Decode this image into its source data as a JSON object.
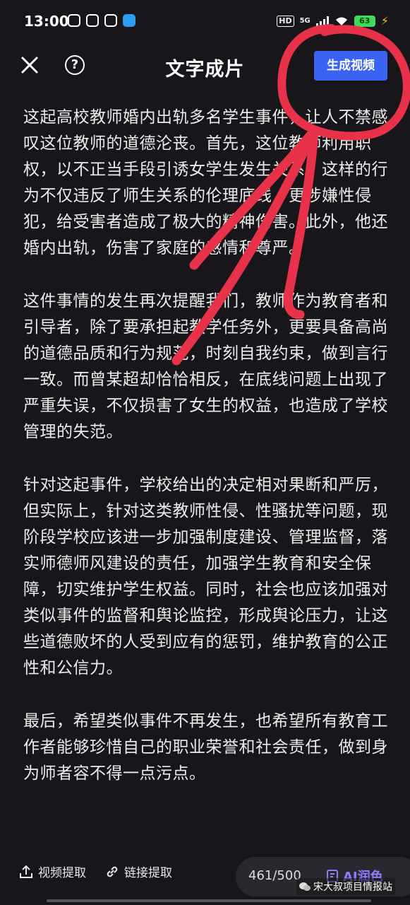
{
  "status_bar": {
    "time": "13:00",
    "hd_label": "HD",
    "network_label": "5G",
    "battery_level": "63"
  },
  "header": {
    "title": "文字成片",
    "generate_button": "生成视频",
    "close_icon": "close-icon",
    "help_icon": "help-circle-icon",
    "help_glyph": "?"
  },
  "article": {
    "paragraphs": [
      "这起高校教师婚内出轨多名学生事件，让人不禁感叹这位教师的道德沦丧。首先，这位教师利用职权，以不正当手段引诱女学生发生关系，这样的行为不仅违反了师生关系的伦理底线，更涉嫌性侵犯，给受害者造成了极大的精神伤害。此外，他还婚内出轨，伤害了家庭的感情和尊严。",
      "这件事情的发生再次提醒我们，教师作为教育者和引导者，除了要承担起教学任务外，更要具备高尚的道德品质和行为规范，时刻自我约束，做到言行一致。而曾某超却恰恰相反，在底线问题上出现了严重失误，不仅损害了女生的权益，也造成了学校管理的失范。",
      "针对这起事件，学校给出的决定相对果断和严厉，但实际上，针对这类教师性侵、性骚扰等问题，现阶段学校应该进一步加强制度建设、管理监督，落实师德师风建设的责任，加强学生教育和安全保障，切实维护学生权益。同时，社会也应该加强对类似事件的监督和舆论监控，形成舆论压力，让这些道德败坏的人受到应有的惩罚，维护教育的公正性和公信力。",
      "最后，希望类似事件不再发生，也希望所有教育工作者能够珍惜自己的职业荣誉和社会责任，做到身为师者容不得一点污点。"
    ]
  },
  "bottom_bar": {
    "video_extract": "视频提取",
    "link_extract": "链接提取",
    "char_count": "461/500",
    "ai_polish": "AI润色",
    "watermark": "宋大叔项目情报站"
  },
  "colors": {
    "background": "#18161b",
    "accent_button": "#3a63f2",
    "annotation_red": "#e8324a",
    "ai_purple": "#8f7cff"
  }
}
